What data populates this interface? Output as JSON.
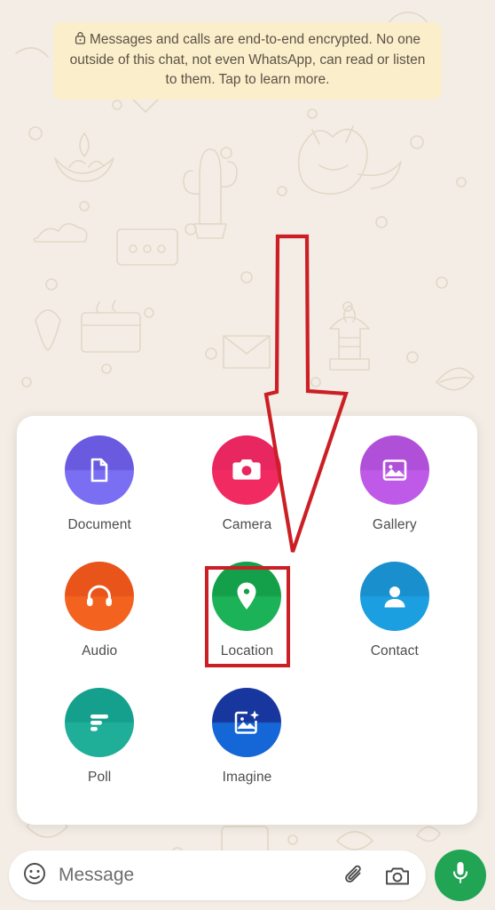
{
  "app": {
    "name": "WhatsApp",
    "screen": "chat-attachment-menu"
  },
  "encryption_banner": {
    "icon": "lock-icon",
    "line1": "Messages and calls are end-to-end encrypted.",
    "line2": "No one outside of this chat, not even WhatsApp,",
    "line3": "can read or listen to them. Tap to learn more.",
    "background": "#fbeecb",
    "text_color": "#5c5245"
  },
  "annotation": {
    "arrow": {
      "color": "#cc1f25",
      "direction": "down",
      "points_to": "Location"
    },
    "highlight_box": {
      "color": "#cc1f25",
      "target": "Location"
    }
  },
  "attachment_panel": {
    "background": "#ffffff",
    "rows": [
      [
        {
          "label": "Document",
          "icon": "document-icon",
          "color": "#6a5ae0"
        },
        {
          "label": "Camera",
          "icon": "camera-icon",
          "color": "#ef2a61"
        },
        {
          "label": "Gallery",
          "icon": "gallery-icon",
          "color": "#bb57e4"
        }
      ],
      [
        {
          "label": "Audio",
          "icon": "headphones-icon",
          "color": "#f2601f"
        },
        {
          "label": "Location",
          "icon": "location-pin-icon",
          "color": "#1ab055"
        },
        {
          "label": "Contact",
          "icon": "person-icon",
          "color": "#1b9cdd"
        }
      ],
      [
        {
          "label": "Poll",
          "icon": "poll-bars-icon",
          "color": "#1cac96"
        },
        {
          "label": "Imagine",
          "icon": "image-sparkle-icon",
          "color": "#1462d2"
        }
      ]
    ]
  },
  "input_bar": {
    "emoji_icon": "emoji-smiley-icon",
    "placeholder": "Message",
    "attach_icon": "paperclip-icon",
    "camera_icon": "camera-outline-icon",
    "mic_icon": "microphone-icon",
    "mic_color": "#21a453"
  }
}
